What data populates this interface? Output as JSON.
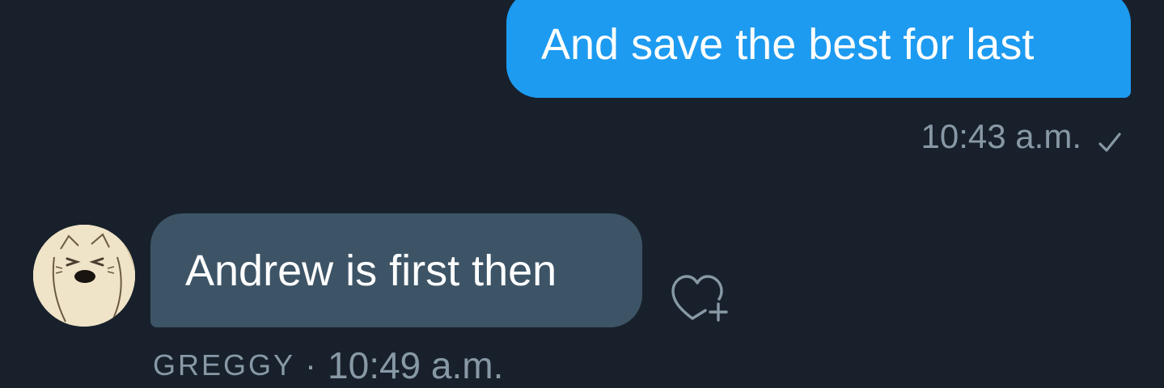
{
  "colors": {
    "background": "#18202b",
    "sent_bubble": "#1d9bf0",
    "received_bubble": "#3d5466",
    "meta_text": "#8899a6"
  },
  "messages": [
    {
      "direction": "sent",
      "text": "And save the best for last",
      "time": "10:43 a.m.",
      "status_icon": "check-icon"
    },
    {
      "direction": "received",
      "text": "Andrew is first then",
      "sender": "GREGGY",
      "separator": "·",
      "time": "10:49 a.m.",
      "avatar_icon": "cat-avatar",
      "reaction_icon": "heart-plus-icon"
    }
  ]
}
